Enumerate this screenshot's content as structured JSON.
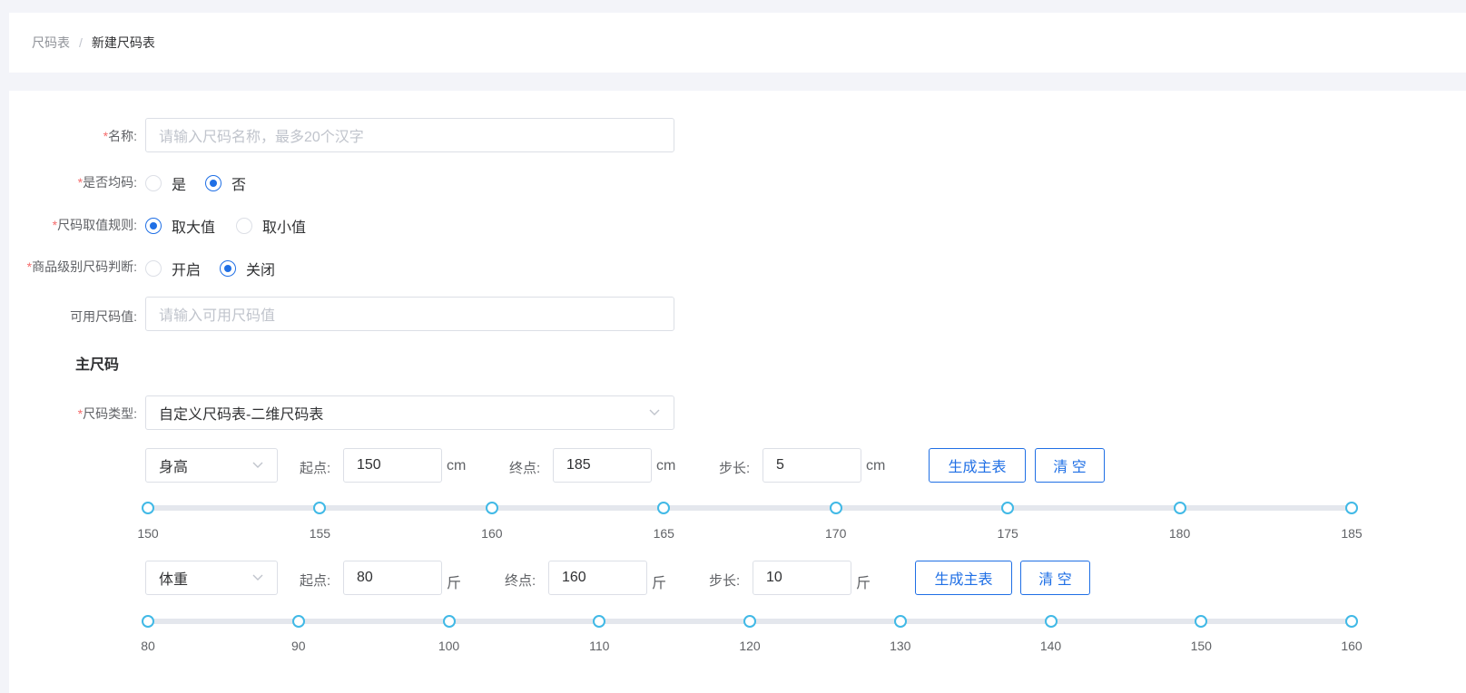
{
  "breadcrumb": {
    "parent": "尺码表",
    "separator": "/",
    "current": "新建尺码表"
  },
  "form": {
    "name": {
      "label": "名称:",
      "placeholder": "请输入尺码名称，最多20个汉字",
      "value": ""
    },
    "is_uniform": {
      "label": "是否均码:",
      "options": [
        "是",
        "否"
      ],
      "selected": "否"
    },
    "rule": {
      "label": "尺码取值规则:",
      "options": [
        "取大值",
        "取小值"
      ],
      "selected": "取大值"
    },
    "product_level": {
      "label": "商品级别尺码判断:",
      "options": [
        "开启",
        "关闭"
      ],
      "selected": "关闭"
    },
    "available": {
      "label": "可用尺码值:",
      "placeholder": "请输入可用尺码值",
      "value": ""
    },
    "required_mark": "*"
  },
  "main_size": {
    "section_title": "主尺码",
    "type_label": "尺码类型:",
    "type_value": "自定义尺码表-二维尺码表",
    "dimensions": [
      {
        "name": "身高",
        "start_label": "起点:",
        "start": "150",
        "unit": "cm",
        "end_label": "终点:",
        "end": "185",
        "step_label": "步长:",
        "step": "5",
        "generate_label": "生成主表",
        "clear_label": "清 空",
        "ticks": [
          "150",
          "155",
          "160",
          "165",
          "170",
          "175",
          "180",
          "185"
        ]
      },
      {
        "name": "体重",
        "start_label": "起点:",
        "start": "80",
        "unit": "斤",
        "end_label": "终点:",
        "end": "160",
        "step_label": "步长:",
        "step": "10",
        "generate_label": "生成主表",
        "clear_label": "清 空",
        "ticks": [
          "80",
          "90",
          "100",
          "110",
          "120",
          "130",
          "140",
          "150",
          "160"
        ]
      }
    ]
  },
  "colors": {
    "primary": "#1f6fe5",
    "slider": "#41b9e6",
    "required": "#f56c6c"
  }
}
